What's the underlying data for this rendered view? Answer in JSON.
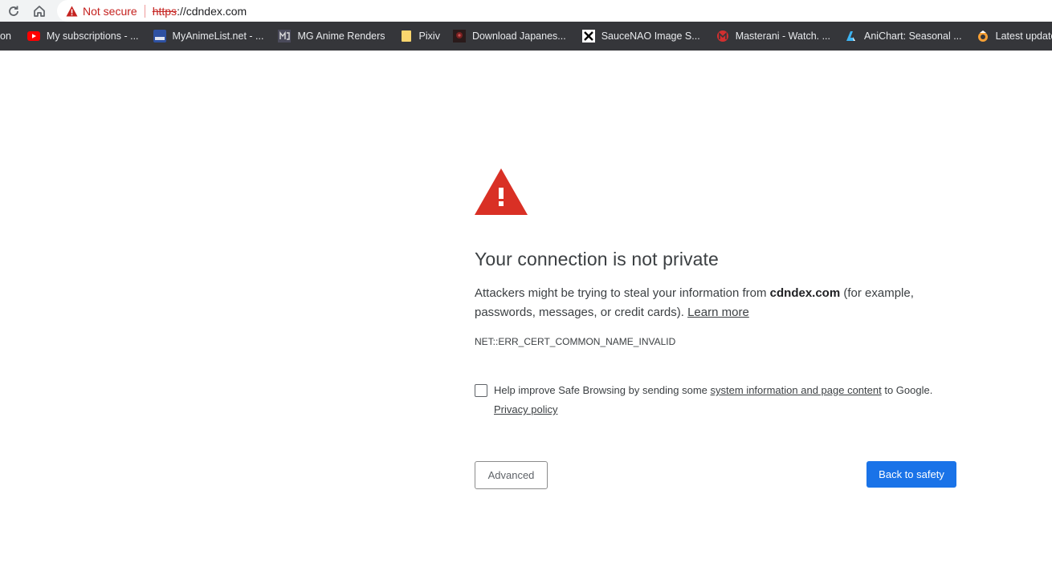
{
  "omnibox": {
    "security_label": "Not secure",
    "url_scheme": "https",
    "url_rest": "://cdndex.com"
  },
  "bookmarks": [
    {
      "label": "on",
      "icon": "bookmark-partial-icon",
      "color": "#35363a"
    },
    {
      "label": "My subscriptions - ...",
      "icon": "youtube-icon",
      "color": "#ff0000"
    },
    {
      "label": "MyAnimeList.net - ...",
      "icon": "mal-icon",
      "color": "#2e51a2"
    },
    {
      "label": "MG Anime Renders",
      "icon": "mg-icon",
      "color": "#4a4a5a"
    },
    {
      "label": "Pixiv",
      "icon": "folder-icon",
      "color": "#f9d56e"
    },
    {
      "label": "Download Japanes...",
      "icon": "site-thumbnail-icon",
      "color": "#7a2020"
    },
    {
      "label": "SauceNAO Image S...",
      "icon": "saucenao-icon",
      "color": "#ffffff"
    },
    {
      "label": "Masterani - Watch. ...",
      "icon": "masterani-icon",
      "color": "#d32f2f"
    },
    {
      "label": "AniChart: Seasonal ...",
      "icon": "anichart-icon",
      "color": "#3db4f2"
    },
    {
      "label": "Latest updates - M...",
      "icon": "mangadex-icon",
      "color": "#f7a035"
    }
  ],
  "interstitial": {
    "heading": "Your connection is not private",
    "explain_prefix": "Attackers might be trying to steal your information from ",
    "explain_host": "cdndex.com",
    "explain_suffix": " (for example, passwords, messages, or credit cards). ",
    "learn_more": "Learn more",
    "error_code": "NET::ERR_CERT_COMMON_NAME_INVALID",
    "sb_prefix": "Help improve Safe Browsing by sending some ",
    "sb_link": "system information and page content",
    "sb_suffix": " to Google.",
    "privacy_policy": "Privacy policy",
    "advanced_button": "Advanced",
    "back_button": "Back to safety"
  },
  "colors": {
    "danger_red": "#d93025",
    "primary_blue": "#1a73e8",
    "bookmark_bar": "#35363a"
  }
}
